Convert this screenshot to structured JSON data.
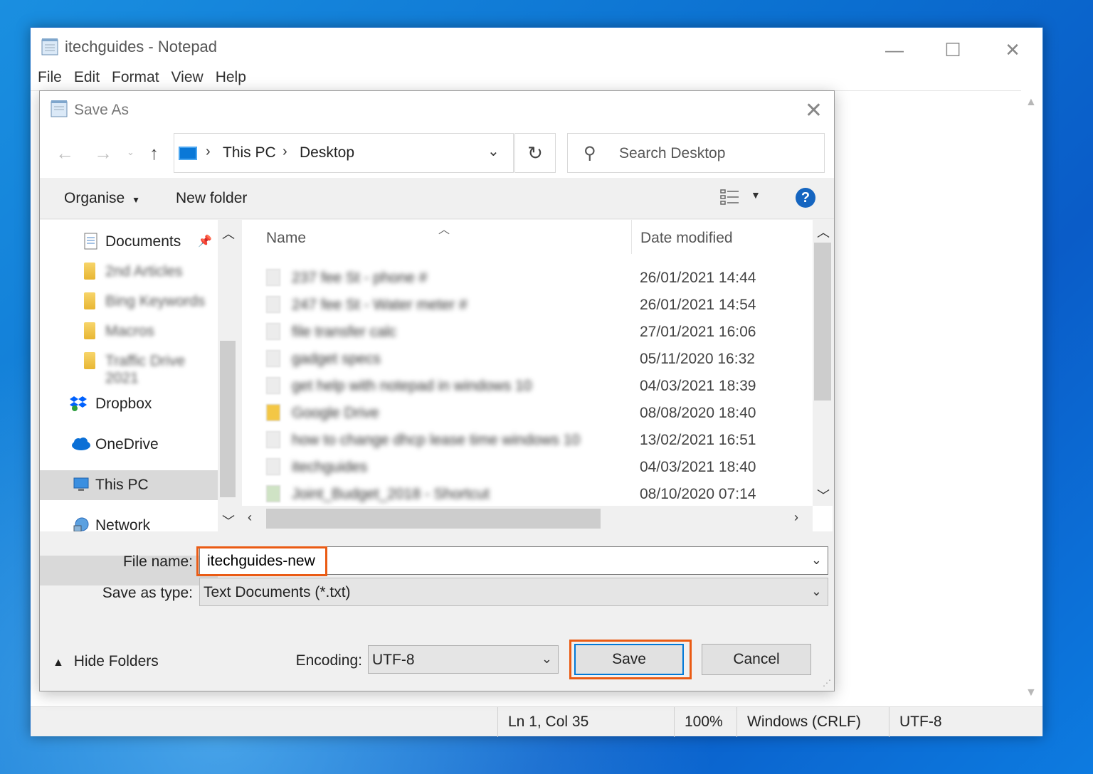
{
  "notepad": {
    "title": "itechguides - Notepad",
    "menu": [
      "File",
      "Edit",
      "Format",
      "View",
      "Help"
    ],
    "status": {
      "position": "Ln 1, Col 35",
      "zoom": "100%",
      "line_ending": "Windows (CRLF)",
      "encoding": "UTF-8"
    }
  },
  "dialog": {
    "title": "Save As",
    "address": {
      "crumbs": [
        "This PC",
        "Desktop"
      ]
    },
    "search": {
      "placeholder": "Search Desktop"
    },
    "toolbar": {
      "organise": "Organise",
      "new_folder": "New folder"
    },
    "nav_pane": {
      "items": [
        {
          "label": "Documents",
          "icon": "documents-icon",
          "pinned": true
        },
        {
          "label": "2nd Articles",
          "icon": "folder-icon",
          "blurred": true
        },
        {
          "label": "Bing Keywords",
          "icon": "folder-icon",
          "blurred": true
        },
        {
          "label": "Macros",
          "icon": "folder-icon",
          "blurred": true
        },
        {
          "label": "Traffic Drive 2021",
          "icon": "folder-icon",
          "blurred": true
        },
        {
          "label": "Dropbox",
          "icon": "dropbox-icon"
        },
        {
          "label": "OneDrive",
          "icon": "onedrive-icon"
        },
        {
          "label": "This PC",
          "icon": "this-pc-icon",
          "selected": true
        },
        {
          "label": "Network",
          "icon": "network-icon"
        }
      ]
    },
    "file_list": {
      "columns": {
        "name": "Name",
        "date": "Date modified"
      },
      "rows": [
        {
          "name": "237 fee St - phone #",
          "date": "26/01/2021 14:44"
        },
        {
          "name": "247 fee St - Water meter #",
          "date": "26/01/2021 14:54"
        },
        {
          "name": "file transfer calc",
          "date": "27/01/2021 16:06"
        },
        {
          "name": "gadget specs",
          "date": "05/11/2020 16:32"
        },
        {
          "name": "get help with notepad in windows 10",
          "date": "04/03/2021 18:39"
        },
        {
          "name": "Google Drive",
          "date": "08/08/2020 18:40"
        },
        {
          "name": "how to change dhcp lease time windows 10",
          "date": "13/02/2021 16:51"
        },
        {
          "name": "itechguides",
          "date": "04/03/2021 18:40"
        },
        {
          "name": "Joint_Budget_2018 - Shortcut",
          "date": "08/10/2020 07:14"
        }
      ]
    },
    "file_name_label": "File name:",
    "file_name_value": "itechguides-new",
    "save_type_label": "Save as type:",
    "save_type_value": "Text Documents (*.txt)",
    "hide_folders": "Hide Folders",
    "encoding_label": "Encoding:",
    "encoding_value": "UTF-8",
    "save_label": "Save",
    "cancel_label": "Cancel"
  },
  "colors": {
    "highlight": "#ea5b14",
    "accent": "#0078d7"
  }
}
